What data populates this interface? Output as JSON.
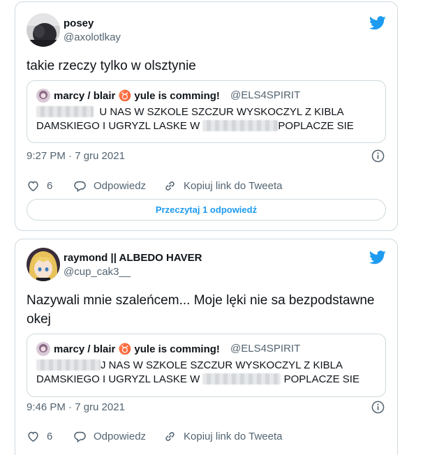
{
  "tweets": [
    {
      "author_name": "posey",
      "author_handle": "@axolotlkay",
      "text": "takie rzeczy tylko w olsztynie",
      "quote": {
        "author_name": "marcy / blair ♉ yule is comming!",
        "author_handle": "@ELS4SPIRIT",
        "line1_text": "U NAS W SZKOLE SZCZUR WYSKOCZYL Z KIBLA",
        "line2_start": "DAMSKIEGO I UGRYZL LASKE W",
        "line2_end": "POPLACZE SIE"
      },
      "timestamp": "9:27 PM · 7 gru 2021",
      "likes": "6",
      "reply_label": "Odpowiedz",
      "copy_link_label": "Kopiuj link do Tweeta",
      "read_replies_label": "Przeczytaj 1 odpowiedź"
    },
    {
      "author_name": "raymond || ALBEDO HAVER",
      "author_handle": "@cup_cak3__",
      "text_line1": "Nazywali mnie szaleńcem... Moje lęki nie sa bezpodstawne",
      "text_line2": "okej",
      "quote": {
        "author_name": "marcy / blair ♉ yule is comming!",
        "author_handle": "@ELS4SPIRIT",
        "line1_text": "J NAS W SZKOLE SZCZUR WYSKOCZYL Z KIBLA",
        "line2_start": "DAMSKIEGO I UGRYZL LASKE W",
        "line2_end": "POPLACZE SIE"
      },
      "timestamp": "9:46 PM · 7 gru 2021",
      "likes": "6",
      "reply_label": "Odpowiedz",
      "copy_link_label": "Kopiuj link do Tweeta"
    }
  ],
  "colors": {
    "accent": "#1d9bf0",
    "text": "#0f1419",
    "secondary": "#536471",
    "border": "#cfd9de"
  },
  "icons": [
    "twitter-bird-icon",
    "info-icon",
    "heart-icon",
    "reply-bubble-icon",
    "link-icon"
  ]
}
